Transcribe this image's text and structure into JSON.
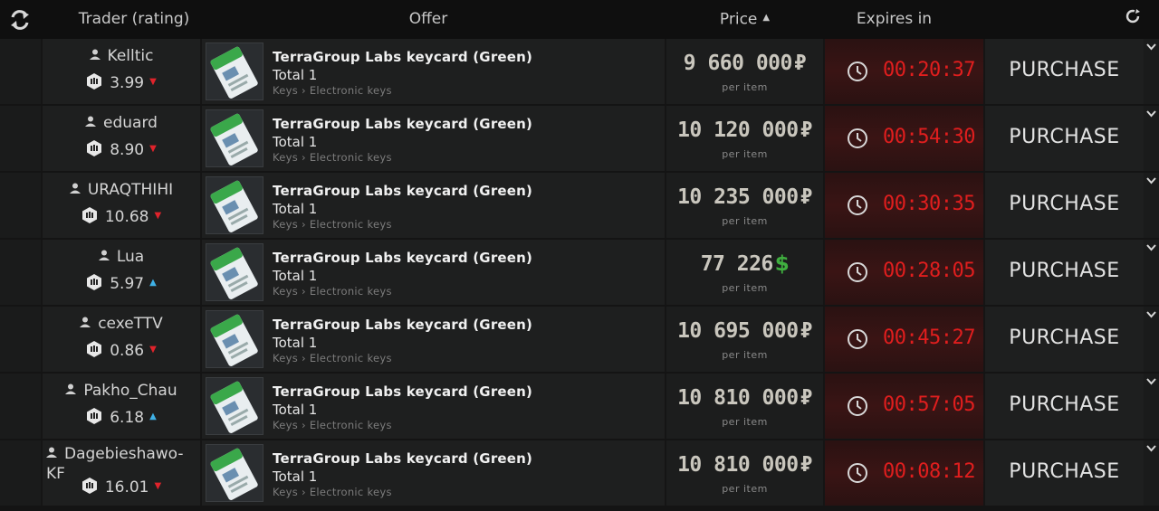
{
  "header": {
    "trader_col": "Trader (rating)",
    "offer_col": "Offer",
    "price_col": "Price",
    "expires_col": "Expires in",
    "refresh_icon": "refresh-icon",
    "settings_icon": "settings-icon",
    "sort_icon": "sort-ascending-icon"
  },
  "colors": {
    "expiry_red": "#e01e1e",
    "usd_green": "#3fae3f",
    "down_arrow": "#e0232b",
    "up_arrow": "#3fb1e6"
  },
  "rows": [
    {
      "trader": "Kelltic",
      "rating": "3.99",
      "trend": "down",
      "item": "TerraGroup Labs keycard (Green)",
      "total": "Total 1",
      "category": "Keys › Electronic keys",
      "price": "9 660 000",
      "currency": "₽",
      "unit": "per item",
      "expires": "00:20:37",
      "action": "PURCHASE"
    },
    {
      "trader": "eduard",
      "rating": "8.90",
      "trend": "down",
      "item": "TerraGroup Labs keycard (Green)",
      "total": "Total 1",
      "category": "Keys › Electronic keys",
      "price": "10 120 000",
      "currency": "₽",
      "unit": "per item",
      "expires": "00:54:30",
      "action": "PURCHASE"
    },
    {
      "trader": "URAQTHIHI",
      "rating": "10.68",
      "trend": "down",
      "item": "TerraGroup Labs keycard (Green)",
      "total": "Total 1",
      "category": "Keys › Electronic keys",
      "price": "10 235 000",
      "currency": "₽",
      "unit": "per item",
      "expires": "00:30:35",
      "action": "PURCHASE"
    },
    {
      "trader": "Lua",
      "rating": "5.97",
      "trend": "up",
      "item": "TerraGroup Labs keycard (Green)",
      "total": "Total 1",
      "category": "Keys › Electronic keys",
      "price": "77 226",
      "currency": "$",
      "unit": "per item",
      "expires": "00:28:05",
      "action": "PURCHASE"
    },
    {
      "trader": "cexeTTV",
      "rating": "0.86",
      "trend": "down",
      "item": "TerraGroup Labs keycard (Green)",
      "total": "Total 1",
      "category": "Keys › Electronic keys",
      "price": "10 695 000",
      "currency": "₽",
      "unit": "per item",
      "expires": "00:45:27",
      "action": "PURCHASE"
    },
    {
      "trader": "Pakho_Chau",
      "rating": "6.18",
      "trend": "up",
      "item": "TerraGroup Labs keycard (Green)",
      "total": "Total 1",
      "category": "Keys › Electronic keys",
      "price": "10 810 000",
      "currency": "₽",
      "unit": "per item",
      "expires": "00:57:05",
      "action": "PURCHASE"
    },
    {
      "trader": "Dagebieshawo-KF",
      "rating": "16.01",
      "trend": "down",
      "item": "TerraGroup Labs keycard (Green)",
      "total": "Total 1",
      "category": "Keys › Electronic keys",
      "price": "10 810 000",
      "currency": "₽",
      "unit": "per item",
      "expires": "00:08:12",
      "action": "PURCHASE"
    }
  ]
}
